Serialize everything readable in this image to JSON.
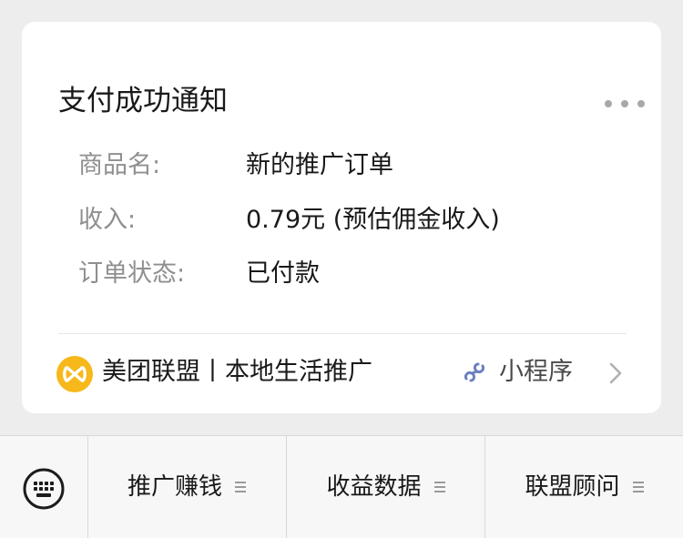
{
  "card": {
    "title": "支付成功通知",
    "rows": [
      {
        "label": "商品名:",
        "value": "新的推广订单"
      },
      {
        "label": "收入:",
        "value": "0.79元 (预估佣金收入)"
      },
      {
        "label": "订单状态:",
        "value": "已付款"
      }
    ],
    "footer": {
      "app_name": "美团联盟丨本地生活推广",
      "mini_program_label": "小程序",
      "logo_icon": "meituan-union-logo",
      "mini_icon": "mini-program-link-icon"
    }
  },
  "menu": {
    "items": [
      {
        "label": "推广赚钱"
      },
      {
        "label": "收益数据"
      },
      {
        "label": "联盟顾问"
      }
    ]
  },
  "colors": {
    "background": "#ededed",
    "card": "#ffffff",
    "logo": "#f6b81a",
    "mini_icon": "#6b7fc0"
  }
}
